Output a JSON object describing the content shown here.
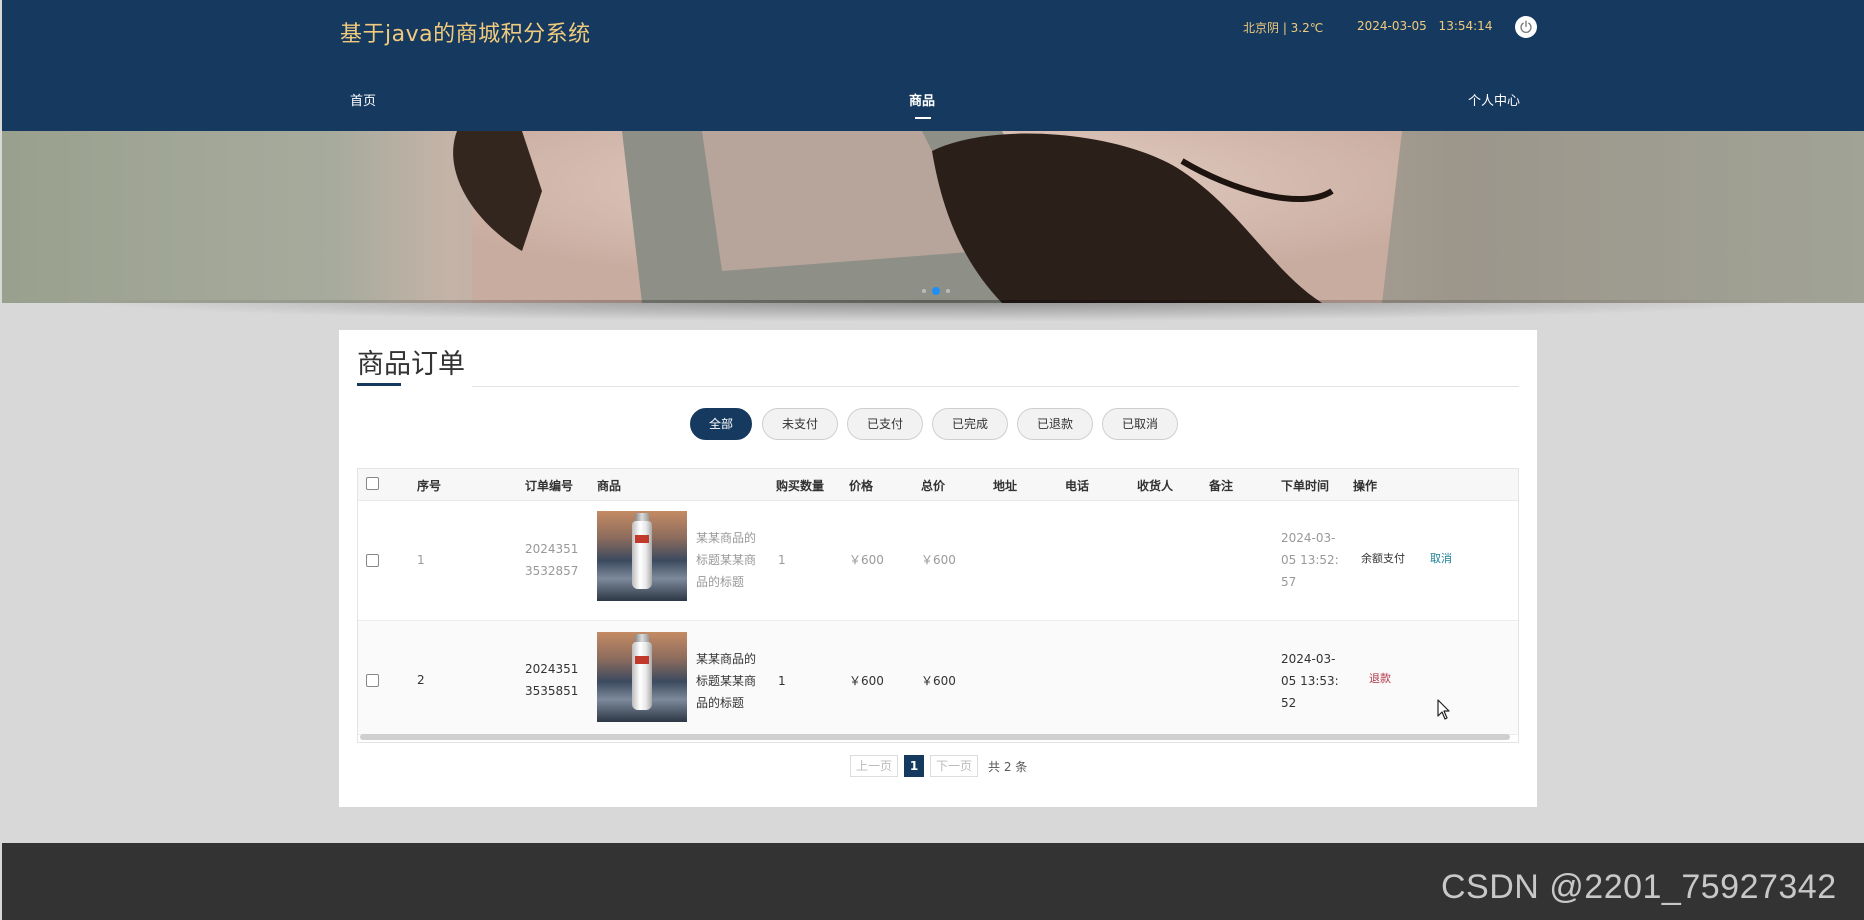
{
  "header": {
    "site_title": "基于java的商城积分系统",
    "weather": "北京阴 | 3.2℃",
    "datetime": "2024-03-05  13:54:14",
    "power_icon": "power-icon"
  },
  "nav": {
    "home": "首页",
    "goods": "商品",
    "personal_center": "个人中心"
  },
  "banner": {
    "slide_count": 3,
    "active_slide": 2
  },
  "page": {
    "title": "商品订单"
  },
  "tabs": [
    "全部",
    "未支付",
    "已支付",
    "已完成",
    "已退款",
    "已取消"
  ],
  "active_tab": 0,
  "table": {
    "headers": {
      "index": "序号",
      "order_no": "订单编号",
      "product": "商品",
      "quantity": "购买数量",
      "price": "价格",
      "total": "总价",
      "address": "地址",
      "phone": "电话",
      "receiver": "收货人",
      "remark": "备注",
      "order_time": "下单时间",
      "actions": "操作"
    },
    "rows": [
      {
        "index": "1",
        "order_no_1": "2024351",
        "order_no_2": "3532857",
        "name_1": "某某商品的",
        "name_2": "标题某某商",
        "name_3": "品的标题",
        "quantity": "1",
        "price": "￥600",
        "total": "￥600",
        "time_1": "2024-03-",
        "time_2": "05 13:52:",
        "time_3": "57",
        "action_pay": "余额支付",
        "action_cancel": "取消"
      },
      {
        "index": "2",
        "order_no_1": "2024351",
        "order_no_2": "3535851",
        "name_1": "某某商品的",
        "name_2": "标题某某商",
        "name_3": "品的标题",
        "quantity": "1",
        "price": "￥600",
        "total": "￥600",
        "time_1": "2024-03-",
        "time_2": "05 13:53:",
        "time_3": "52",
        "action_refund": "退款"
      }
    ]
  },
  "pagination": {
    "prev": "上一页",
    "current": "1",
    "next": "下一页",
    "total": "共 2 条"
  },
  "watermark": "CSDN @2201_75927342",
  "colors": {
    "header_bg": "#163a5f",
    "title_gold": "#f1cb7d",
    "footer_bg": "#333333",
    "page_bg": "#d8d8d8"
  }
}
